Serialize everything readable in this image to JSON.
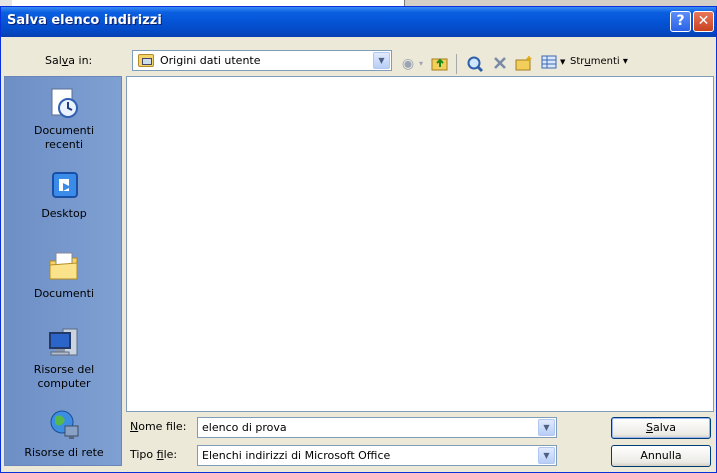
{
  "window": {
    "title": "Salva elenco indirizzi",
    "help_label": "?",
    "close_label": "✕"
  },
  "save_in": {
    "label_pre": "Sal",
    "label_u": "v",
    "label_post": "a in:",
    "value": "Origini dati utente"
  },
  "toolbar": {
    "back_icon": "back-arrow-icon",
    "up_icon": "up-folder-icon",
    "search_icon": "search-web-icon",
    "delete_icon": "delete-icon",
    "new_folder_icon": "new-folder-icon",
    "views_icon": "views-icon",
    "tools_pre": "Str",
    "tools_u": "u",
    "tools_post": "menti",
    "tools_arrow": "▾"
  },
  "places": [
    {
      "label1": "Documenti",
      "label2": "recenti",
      "icon": "recent-documents-icon"
    },
    {
      "label1": "Desktop",
      "label2": "",
      "icon": "desktop-icon"
    },
    {
      "label1": "Documenti",
      "label2": "",
      "icon": "my-documents-icon"
    },
    {
      "label1": "Risorse del",
      "label2": "computer",
      "icon": "my-computer-icon"
    },
    {
      "label1": "Risorse di rete",
      "label2": "",
      "icon": "network-icon"
    }
  ],
  "filename": {
    "label_u": "N",
    "label_post": "ome file:",
    "value": "elenco di prova"
  },
  "filetype": {
    "label_pre": "Tipo ",
    "label_u": "f",
    "label_post": "ile:",
    "value": "Elenchi indirizzi di Microsoft Office"
  },
  "buttons": {
    "save_u": "S",
    "save_post": "alva",
    "cancel": "Annulla"
  },
  "colors": {
    "titlebar": "#0553d6",
    "dialog_bg": "#ece9d8",
    "places_bg": "#7396c9"
  }
}
